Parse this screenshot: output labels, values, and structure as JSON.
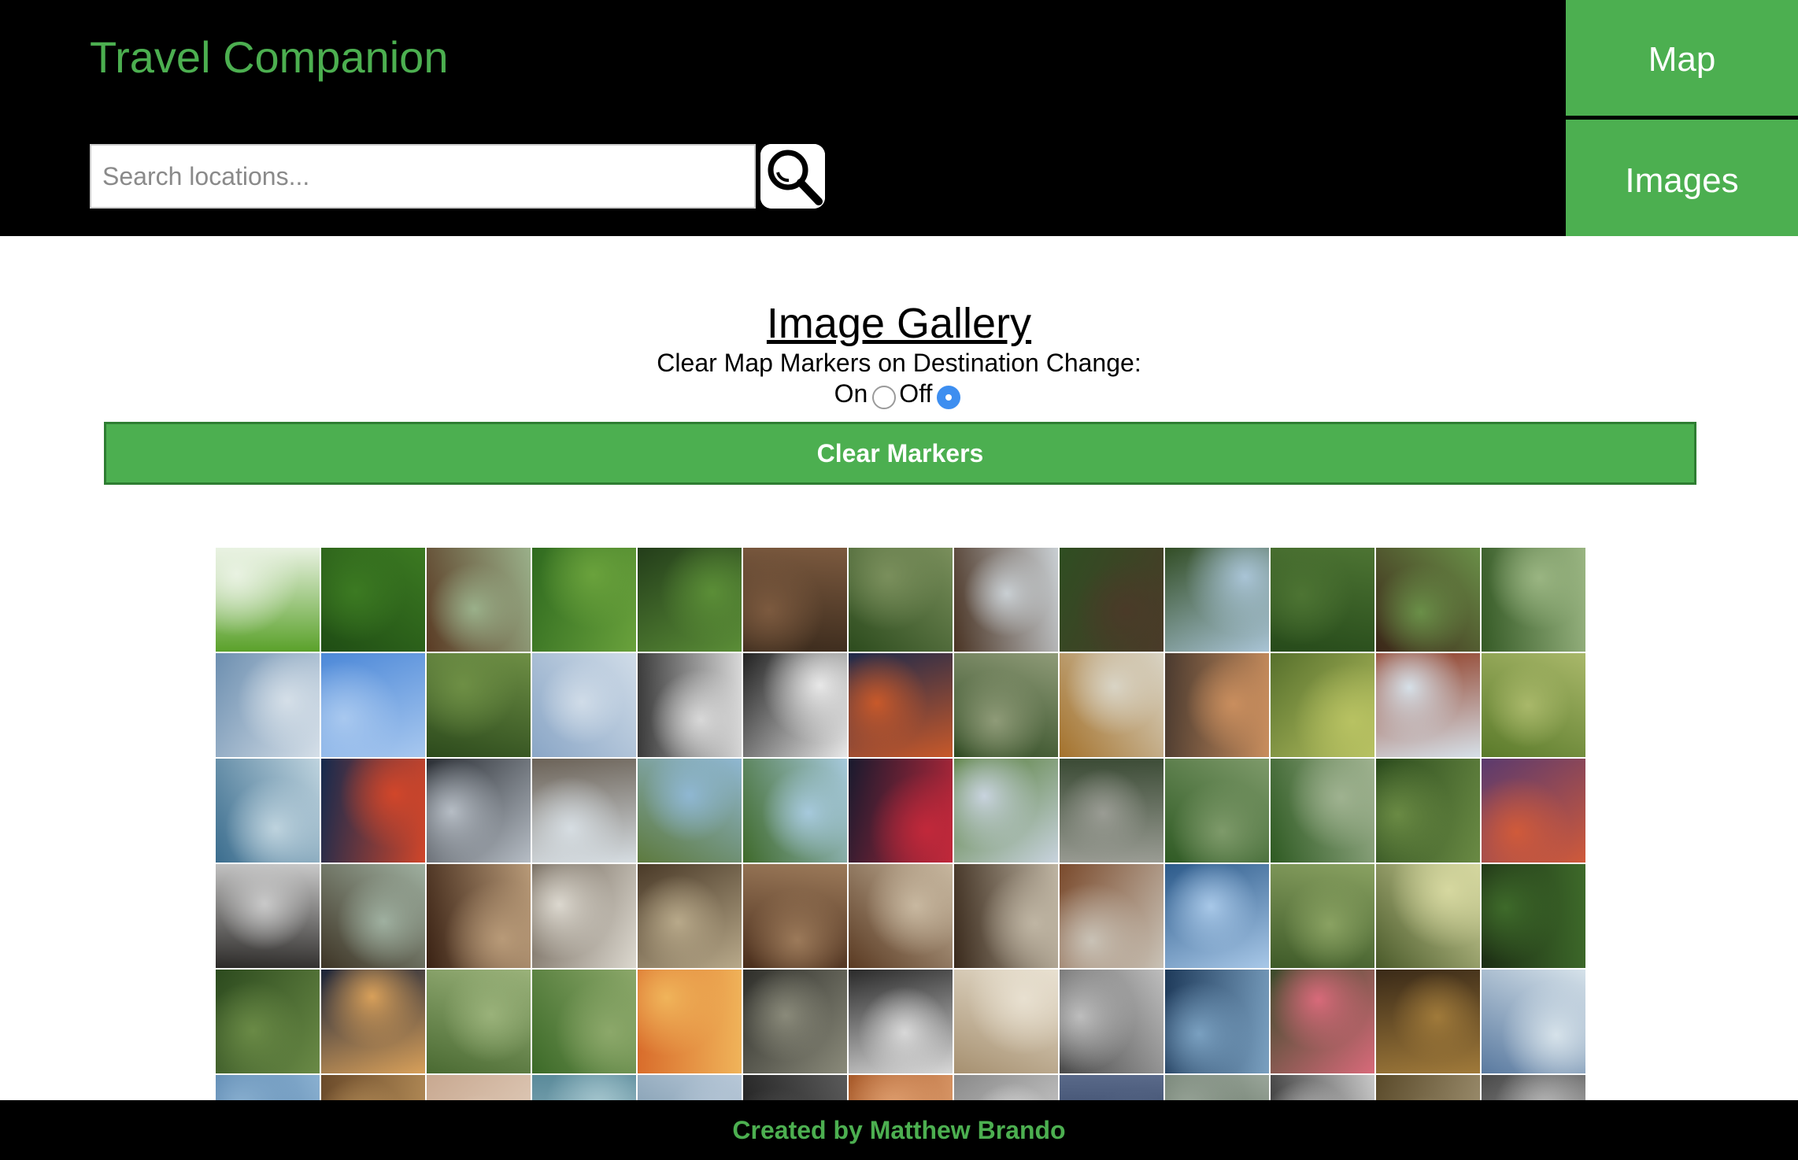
{
  "header": {
    "app_title": "Travel Companion",
    "search_placeholder": "Search locations...",
    "search_icon": "magnifier-icon",
    "nav": {
      "map_label": "Map",
      "images_label": "Images"
    }
  },
  "main": {
    "gallery_title": "Image Gallery",
    "clear_option_label": "Clear Map Markers on Destination Change:",
    "radio_on_label": "On",
    "radio_off_label": "Off",
    "selected_option": "Off",
    "clear_button_label": "Clear Markers"
  },
  "gallery": {
    "columns": 13,
    "rows_visible": 6,
    "tiles": [
      {
        "t": "temple-roof",
        "c1": "#5aa12a",
        "c2": "#e9f2e2"
      },
      {
        "t": "garden-foliage",
        "c1": "#1f4d14",
        "c2": "#3c7a22"
      },
      {
        "t": "wooden-house",
        "c1": "#5a3b24",
        "c2": "#9ab08a"
      },
      {
        "t": "forest-path",
        "c1": "#2f6a1f",
        "c2": "#6aa23c"
      },
      {
        "t": "forest-canopy",
        "c1": "#233d1a",
        "c2": "#5b8e37"
      },
      {
        "t": "veranda-garden",
        "c1": "#3a2a1c",
        "c2": "#7c5a3f"
      },
      {
        "t": "garden-house",
        "c1": "#2c4b1d",
        "c2": "#7a8f5c"
      },
      {
        "t": "traditional-house",
        "c1": "#4a3424",
        "c2": "#c9cfd3"
      },
      {
        "t": "garden-pavilion",
        "c1": "#2f4e22",
        "c2": "#4a3a28"
      },
      {
        "t": "tea-house",
        "c1": "#324d25",
        "c2": "#a9c4d6"
      },
      {
        "t": "garden-trees",
        "c1": "#264a1a",
        "c2": "#4d7433"
      },
      {
        "t": "wooden-veranda",
        "c1": "#3b2618",
        "c2": "#6a8f48"
      },
      {
        "t": "zen-garden",
        "c1": "#355a26",
        "c2": "#9ab582"
      },
      {
        "t": "glass-tower",
        "c1": "#6d8fb0",
        "c2": "#d5dfe8"
      },
      {
        "t": "modern-roof",
        "c1": "#4c88d8",
        "c2": "#a8c8ef"
      },
      {
        "t": "green-canopy",
        "c1": "#2c4a1c",
        "c2": "#6e8f45"
      },
      {
        "t": "tokyo-skyline",
        "c1": "#8aa6c6",
        "c2": "#d0dce8"
      },
      {
        "t": "bw-interior",
        "c1": "#3a3a3a",
        "c2": "#d8d8d8"
      },
      {
        "t": "bw-stairs",
        "c1": "#222222",
        "c2": "#e8e8e8"
      },
      {
        "t": "tokyo-tower-night",
        "c1": "#1f2a4a",
        "c2": "#c8592a"
      },
      {
        "t": "picnic-people",
        "c1": "#2f4a22",
        "c2": "#8f9b78"
      },
      {
        "t": "autumn-skytree",
        "c1": "#a4722c",
        "c2": "#d9d4c5"
      },
      {
        "t": "couple-portrait",
        "c1": "#4a3a2f",
        "c2": "#c98e5e"
      },
      {
        "t": "child-forest",
        "c1": "#56702c",
        "c2": "#b8c262"
      },
      {
        "t": "pagoda",
        "c1": "#8e3a22",
        "c2": "#d6e0e8"
      },
      {
        "t": "child-grass",
        "c1": "#5a7a2a",
        "c2": "#a9b86a"
      },
      {
        "t": "city-tower-dusk",
        "c1": "#3b6d8e",
        "c2": "#bed3de"
      },
      {
        "t": "tokyo-tower-blue",
        "c1": "#152a4e",
        "c2": "#d1462a"
      },
      {
        "t": "library-atrium",
        "c1": "#2a2e34",
        "c2": "#b6bdc5"
      },
      {
        "t": "modern-pavilion",
        "c1": "#6b6257",
        "c2": "#d6dde2"
      },
      {
        "t": "pond-garden",
        "c1": "#5d7a3e",
        "c2": "#8fb7d2"
      },
      {
        "t": "garden-pond",
        "c1": "#3f6a2b",
        "c2": "#a6c9dc"
      },
      {
        "t": "fireworks-tower",
        "c1": "#181a2e",
        "c2": "#c1283a"
      },
      {
        "t": "city-park",
        "c1": "#4f7830",
        "c2": "#c8d3de"
      },
      {
        "t": "stone-garden",
        "c1": "#3a4a34",
        "c2": "#9a9c94"
      },
      {
        "t": "stream-garden",
        "c1": "#2f5a24",
        "c2": "#7e9a6a"
      },
      {
        "t": "stepping-stones",
        "c1": "#2e5a22",
        "c2": "#9fb290"
      },
      {
        "t": "forest-trail",
        "c1": "#2a4a1c",
        "c2": "#6a8a44"
      },
      {
        "t": "tokyo-tower-sunset",
        "c1": "#5a3a6e",
        "c2": "#d05a3a"
      },
      {
        "t": "window-frame",
        "c1": "#2c2a28",
        "c2": "#c9c9c9"
      },
      {
        "t": "library-hall",
        "c1": "#3e3526",
        "c2": "#9fb0a0"
      },
      {
        "t": "chandelier-room",
        "c1": "#3a2214",
        "c2": "#b89a78"
      },
      {
        "t": "shoji-doors",
        "c1": "#6a5f52",
        "c2": "#dcd8cf"
      },
      {
        "t": "tatami-room",
        "c1": "#4a3a28",
        "c2": "#b8a98a"
      },
      {
        "t": "wooden-hall",
        "c1": "#4a2e1c",
        "c2": "#9c7a5a"
      },
      {
        "t": "dojo-room",
        "c1": "#5a3a22",
        "c2": "#c8b8a0"
      },
      {
        "t": "wooden-corridor",
        "c1": "#3a2a1c",
        "c2": "#bfb5a3"
      },
      {
        "t": "shrine-gate",
        "c1": "#7a4a2c",
        "c2": "#c9c2b6"
      },
      {
        "t": "glass-facade",
        "c1": "#2c5a8a",
        "c2": "#a8c8e8"
      },
      {
        "t": "bamboo-grove",
        "c1": "#3e5a28",
        "c2": "#8aa262"
      },
      {
        "t": "sunlit-forest",
        "c1": "#4a5a2a",
        "c2": "#d6d8a0"
      },
      {
        "t": "dark-grove",
        "c1": "#1c2e14",
        "c2": "#3e6a2a"
      },
      {
        "t": "forest-hiker",
        "c1": "#2c4a1e",
        "c2": "#6a8a46"
      },
      {
        "t": "city-night",
        "c1": "#1a2338",
        "c2": "#d8a05a"
      },
      {
        "t": "park-trees",
        "c1": "#4a6a32",
        "c2": "#9ab27a"
      },
      {
        "t": "park-lawn",
        "c1": "#3c6a28",
        "c2": "#8ca86a"
      },
      {
        "t": "tower-sunset",
        "c1": "#d86a2a",
        "c2": "#f0b45a"
      },
      {
        "t": "temple-gate-crowd",
        "c1": "#2e2e2a",
        "c2": "#8a8a7a"
      },
      {
        "t": "restaurant",
        "c1": "#2a2a2a",
        "c2": "#d8d8d8"
      },
      {
        "t": "museum-exhibit",
        "c1": "#a69070",
        "c2": "#e8e0d0"
      },
      {
        "t": "bw-building",
        "c1": "#4a4a4a",
        "c2": "#bdbdbd"
      },
      {
        "t": "water-window",
        "c1": "#1e3a5a",
        "c2": "#7aa0c0"
      },
      {
        "t": "flamingos",
        "c1": "#3a4a2a",
        "c2": "#d86a7a"
      },
      {
        "t": "forest-shrine",
        "c1": "#3a2a18",
        "c2": "#a07a3a"
      },
      {
        "t": "glass-hall",
        "c1": "#5a7aa0",
        "c2": "#d6e2ea"
      },
      {
        "t": "partial-1",
        "c1": "#3a6a9a",
        "c2": "#8ab0d0"
      },
      {
        "t": "partial-2",
        "c1": "#6a4a2a",
        "c2": "#b8905a"
      },
      {
        "t": "partial-3",
        "c1": "#c8a890",
        "c2": "#e8d8c8"
      },
      {
        "t": "partial-4",
        "c1": "#5a8a9a",
        "c2": "#a8c8d0"
      },
      {
        "t": "partial-5",
        "c1": "#6a8aa0",
        "c2": "#b8c8d8"
      },
      {
        "t": "partial-6",
        "c1": "#1a1a1a",
        "c2": "#5a5a5a"
      },
      {
        "t": "partial-7",
        "c1": "#a85a2a",
        "c2": "#e0a070"
      },
      {
        "t": "partial-8",
        "c1": "#8a8a8a",
        "c2": "#e0e0e0"
      },
      {
        "t": "partial-9",
        "c1": "#1a2a4a",
        "c2": "#5a6a8a"
      },
      {
        "t": "partial-10",
        "c1": "#3a4a3a",
        "c2": "#9aa69a"
      },
      {
        "t": "partial-11",
        "c1": "#2a2a2a",
        "c2": "#c8c8c8"
      },
      {
        "t": "partial-12",
        "c1": "#5a4a2a",
        "c2": "#a89a7a"
      },
      {
        "t": "partial-13",
        "c1": "#4a4a4a",
        "c2": "#bcbcbc"
      }
    ]
  },
  "footer": {
    "credit": "Created by Matthew Brando"
  },
  "colors": {
    "accent": "#4caf50",
    "accent_dark": "#2e7d32",
    "header_bg": "#000000",
    "radio_selected": "#3d8ef0"
  }
}
